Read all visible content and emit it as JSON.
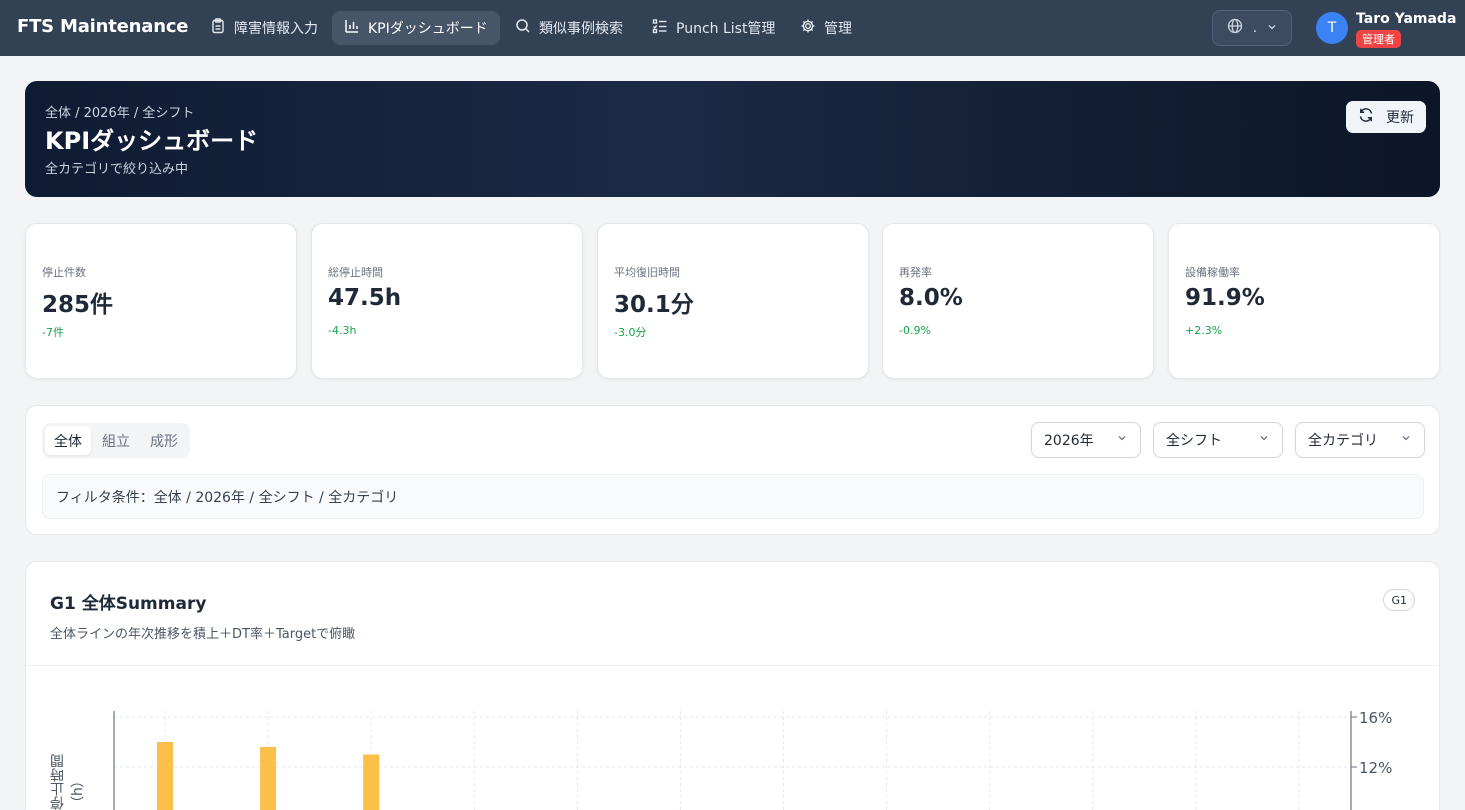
{
  "app": {
    "brand": "FTS Maintenance"
  },
  "nav": {
    "items": [
      {
        "label": "障害情報入力",
        "icon": "clipboard-icon"
      },
      {
        "label": "KPIダッシュボード",
        "icon": "bar-chart-icon"
      },
      {
        "label": "類似事例検索",
        "icon": "search-icon"
      },
      {
        "label": "Punch List管理",
        "icon": "list-check-icon"
      },
      {
        "label": "管理",
        "icon": "gear-icon"
      }
    ],
    "active": "KPIダッシュボード"
  },
  "lang": {
    "icon": "globe-icon",
    "value": "."
  },
  "user": {
    "initial": "T",
    "name": "Taro Yamada",
    "role": "管理者"
  },
  "hero": {
    "breadcrumb": "全体 / 2026年 / 全シフト",
    "title": "KPIダッシュボード",
    "subtitle": "全カテゴリで絞り込み中",
    "refresh_label": "更新"
  },
  "kpis": [
    {
      "label": "停止件数",
      "value": "285件",
      "delta": "-7件"
    },
    {
      "label": "総停止時間",
      "value": "47.5h",
      "delta": "-4.3h"
    },
    {
      "label": "平均復旧時間",
      "value": "30.1分",
      "delta": "-3.0分"
    },
    {
      "label": "再発率",
      "value": "8.0%",
      "delta": "-0.9%"
    },
    {
      "label": "設備稼働率",
      "value": "91.9%",
      "delta": "+2.3%"
    }
  ],
  "filters": {
    "segments": [
      "全体",
      "組立",
      "成形"
    ],
    "active_segment": "全体",
    "year": "2026年",
    "shift": "全シフト",
    "category": "全カテゴリ",
    "condition": "フィルタ条件：全体 / 2026年 / 全シフト / 全カテゴリ"
  },
  "chart_section": {
    "title": "G1 全体Summary",
    "description": "全体ラインの年次推移を積上＋DT率＋Targetで俯瞰",
    "tag": "G1"
  },
  "chart_data": {
    "type": "bar",
    "ylabel": "停止時間（h）",
    "y2_ticks": [
      "16%",
      "12%"
    ],
    "y2lim": [
      0,
      16
    ],
    "visible_bar_tops_percent_scale": [
      14.0,
      13.6,
      13.0
    ],
    "bar_color": "#fbbf4a",
    "grid": true
  },
  "colors": {
    "accent": "#3b82f6",
    "positive": "#16a34a",
    "badge": "#ef4444",
    "nav_bg": "#334155"
  }
}
